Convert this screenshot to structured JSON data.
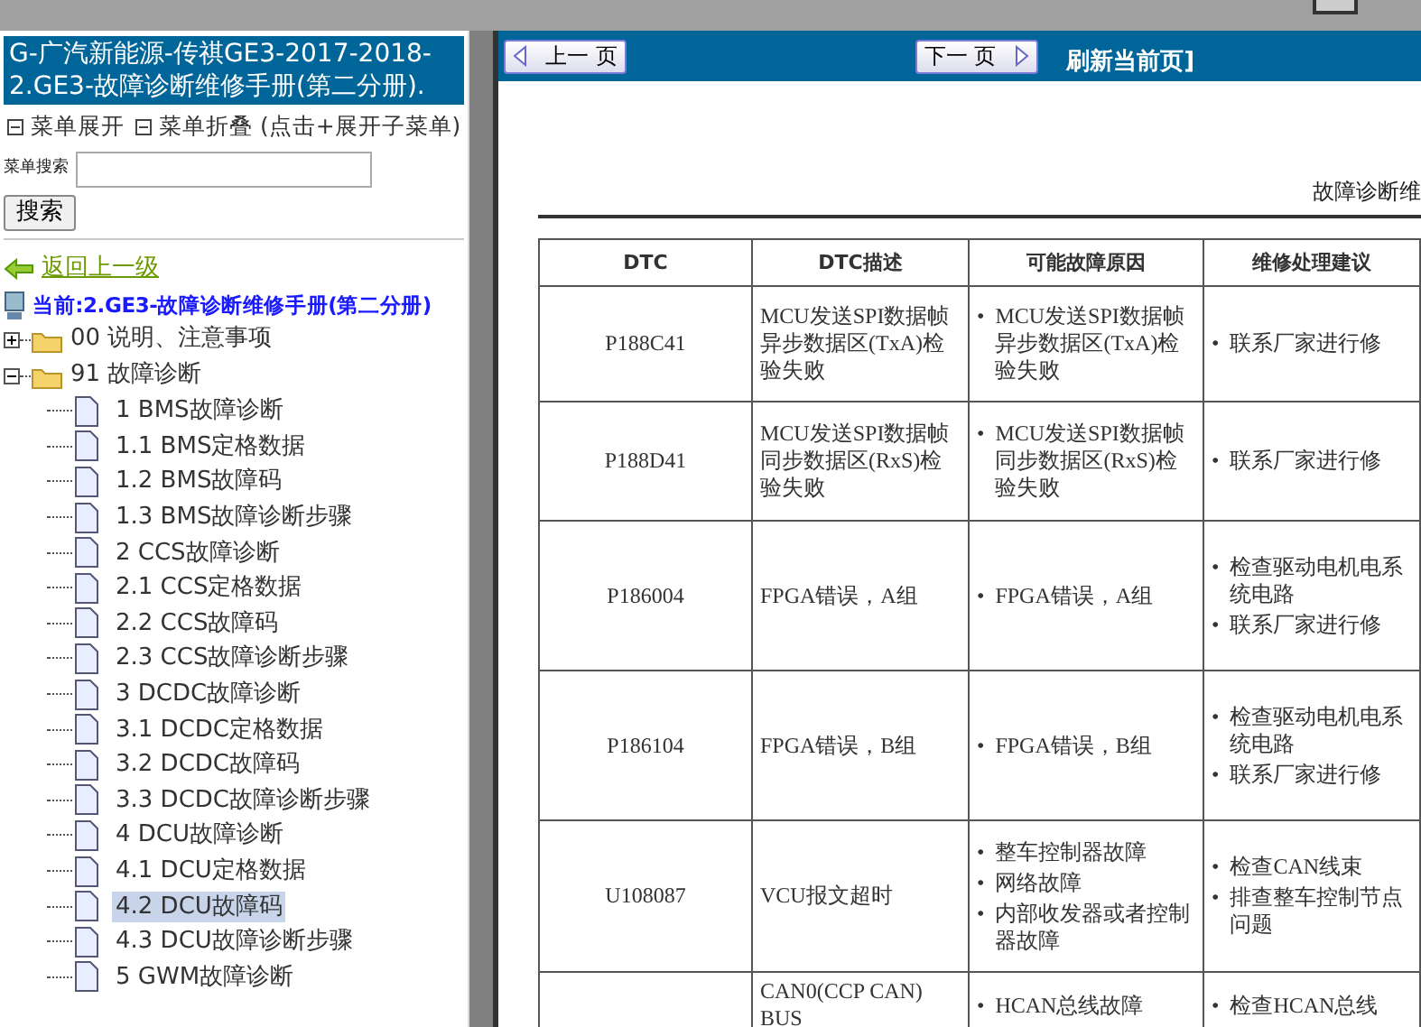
{
  "sidebar": {
    "title": "G-广汽新能源-传祺GE3-2017-2018- 2.GE3-故障诊断维修手册(第二分册).",
    "expand_label": "菜单展开",
    "collapse_label": "菜单折叠 (点击+展开子菜单)",
    "search_label": "菜单搜索",
    "search_button": "搜索",
    "back_link": "返回上一级",
    "current": "当前:2.GE3-故障诊断维修手册(第二分册)",
    "tree": [
      {
        "label": "00 说明、注意事项",
        "expanded": false
      },
      {
        "label": "91 故障诊断",
        "expanded": true,
        "children": [
          {
            "label": "1 BMS故障诊断",
            "selected": false
          },
          {
            "label": "1.1 BMS定格数据",
            "selected": false
          },
          {
            "label": "1.2 BMS故障码",
            "selected": false
          },
          {
            "label": "1.3 BMS故障诊断步骤",
            "selected": false
          },
          {
            "label": "2 CCS故障诊断",
            "selected": false
          },
          {
            "label": "2.1 CCS定格数据",
            "selected": false
          },
          {
            "label": "2.2 CCS故障码",
            "selected": false
          },
          {
            "label": "2.3 CCS故障诊断步骤",
            "selected": false
          },
          {
            "label": "3 DCDC故障诊断",
            "selected": false
          },
          {
            "label": "3.1 DCDC定格数据",
            "selected": false
          },
          {
            "label": "3.2 DCDC故障码",
            "selected": false
          },
          {
            "label": "3.3 DCDC故障诊断步骤",
            "selected": false
          },
          {
            "label": "4 DCU故障诊断",
            "selected": false
          },
          {
            "label": "4.1 DCU定格数据",
            "selected": false
          },
          {
            "label": "4.2 DCU故障码",
            "selected": true
          },
          {
            "label": "4.3 DCU故障诊断步骤",
            "selected": false
          },
          {
            "label": "5 GWM故障诊断",
            "selected": false
          }
        ]
      }
    ]
  },
  "nav": {
    "prev": "上一 页",
    "next": "下一 页",
    "refresh": "刷新当前页]"
  },
  "document": {
    "caption": "故障诊断维",
    "bullet": "•",
    "columns": [
      "DTC",
      "DTC描述",
      "可能故障原因",
      "维修处理建议"
    ],
    "rows": [
      {
        "dtc": "P188C41",
        "description": "MCU发送SPI数据帧异步数据区(TxA)检验失败",
        "causes": [
          "MCU发送SPI数据帧异步数据区(TxA)检验失败"
        ],
        "actions": [
          "联系厂家进行修"
        ]
      },
      {
        "dtc": "P188D41",
        "description": "MCU发送SPI数据帧同步数据区(RxS)检验失败",
        "causes": [
          "MCU发送SPI数据帧同步数据区(RxS)检验失败"
        ],
        "actions": [
          "联系厂家进行修"
        ]
      },
      {
        "dtc": "P186004",
        "description": "FPGA错误，A组",
        "causes": [
          "FPGA错误，A组"
        ],
        "actions": [
          "检查驱动电机电系统电路",
          "联系厂家进行修"
        ]
      },
      {
        "dtc": "P186104",
        "description": "FPGA错误，B组",
        "causes": [
          "FPGA错误，B组"
        ],
        "actions": [
          "检查驱动电机电系统电路",
          "联系厂家进行修"
        ]
      },
      {
        "dtc": "U108087",
        "description": "VCU报文超时",
        "causes": [
          "整车控制器故障",
          "网络故障",
          "内部收发器或者控制器故障"
        ],
        "actions": [
          "检查CAN线束",
          "排查整车控制节点问题"
        ]
      },
      {
        "dtc": "",
        "description": "CAN0(CCP CAN) BUS",
        "causes": [
          "HCAN总线故障"
        ],
        "actions": [
          "检查HCAN总线"
        ]
      }
    ]
  }
}
